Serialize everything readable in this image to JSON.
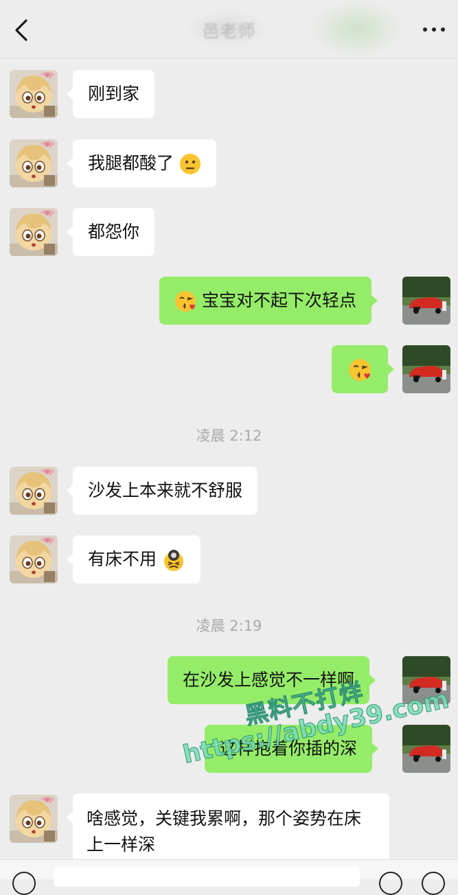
{
  "header": {
    "title": "邑老师",
    "back_icon": "chevron-left-icon",
    "more_icon": "ellipsis-icon"
  },
  "messages": [
    {
      "side": "in",
      "type": "text",
      "text": "刚到家"
    },
    {
      "side": "in",
      "type": "text",
      "text": "我腿都酸了",
      "emoji": "neutral-face-emoji"
    },
    {
      "side": "in",
      "type": "text",
      "text": "都怨你"
    },
    {
      "side": "out",
      "type": "text",
      "text": "宝宝对不起下次轻点",
      "emoji_before": "kissing-face-emoji"
    },
    {
      "side": "out",
      "type": "emoji",
      "emoji": "kissing-face-emoji"
    },
    {
      "type": "timestamp",
      "text": "凌晨 2:12"
    },
    {
      "side": "in",
      "type": "text",
      "text": "沙发上本来就不舒服"
    },
    {
      "side": "in",
      "type": "text",
      "text": "有床不用",
      "emoji": "frustrated-face-emoji"
    },
    {
      "type": "timestamp",
      "text": "凌晨 2:19"
    },
    {
      "side": "out",
      "type": "text",
      "text": "在沙发上感觉不一样啊"
    },
    {
      "side": "out",
      "type": "text",
      "text": "这样抱着你插的深"
    },
    {
      "side": "in",
      "type": "text",
      "text": "啥感觉，关键我累啊，那个姿势在床上一样深"
    }
  ],
  "avatars": {
    "incoming": "anime-girl-avatar",
    "outgoing": "red-car-avatar"
  },
  "watermark": {
    "line1": "黑料不打烊",
    "line2": "https://abdy39.com"
  },
  "colors": {
    "background": "#ededed",
    "outgoing_bubble": "#95ec69",
    "incoming_bubble": "#ffffff",
    "timestamp": "#a9a9a9"
  }
}
